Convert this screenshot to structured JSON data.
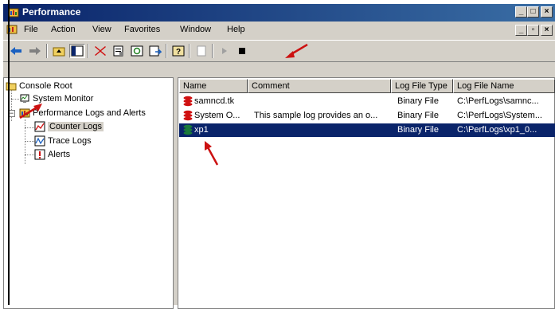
{
  "window": {
    "title": "Performance",
    "caption_buttons": {
      "minimize": "_",
      "maximize": "□",
      "close": "×"
    }
  },
  "menu": {
    "items": [
      "File",
      "Action",
      "View",
      "Favorites",
      "Window",
      "Help"
    ],
    "mdi_buttons": {
      "minimize": "_",
      "restore": "▫",
      "close": "×"
    }
  },
  "tree": {
    "root": "Console Root",
    "system_monitor": "System Monitor",
    "perf_logs": "Performance Logs and Alerts",
    "counter_logs": "Counter Logs",
    "trace_logs": "Trace Logs",
    "alerts": "Alerts",
    "expander": "−"
  },
  "list": {
    "columns": [
      "Name",
      "Comment",
      "Log File Type",
      "Log File Name"
    ],
    "rows": [
      {
        "name": "samncd.tk",
        "comment": "",
        "type": "Binary File",
        "file": "C:\\PerfLogs\\samnc...",
        "status_color": "#d01010",
        "selected": false
      },
      {
        "name": "System O...",
        "comment": "This sample log provides an o...",
        "type": "Binary File",
        "file": "C:\\PerfLogs\\System...",
        "status_color": "#d01010",
        "selected": false
      },
      {
        "name": "xp1",
        "comment": "",
        "type": "Binary File",
        "file": "C:\\PerfLogs\\xp1_0...",
        "status_color": "#1a7a3a",
        "selected": true
      }
    ]
  },
  "colors": {
    "title_gradient_start": "#0a246a",
    "title_gradient_end": "#3a6ea5",
    "selection": "#0a246a",
    "annotation_arrow": "#cc1111"
  }
}
